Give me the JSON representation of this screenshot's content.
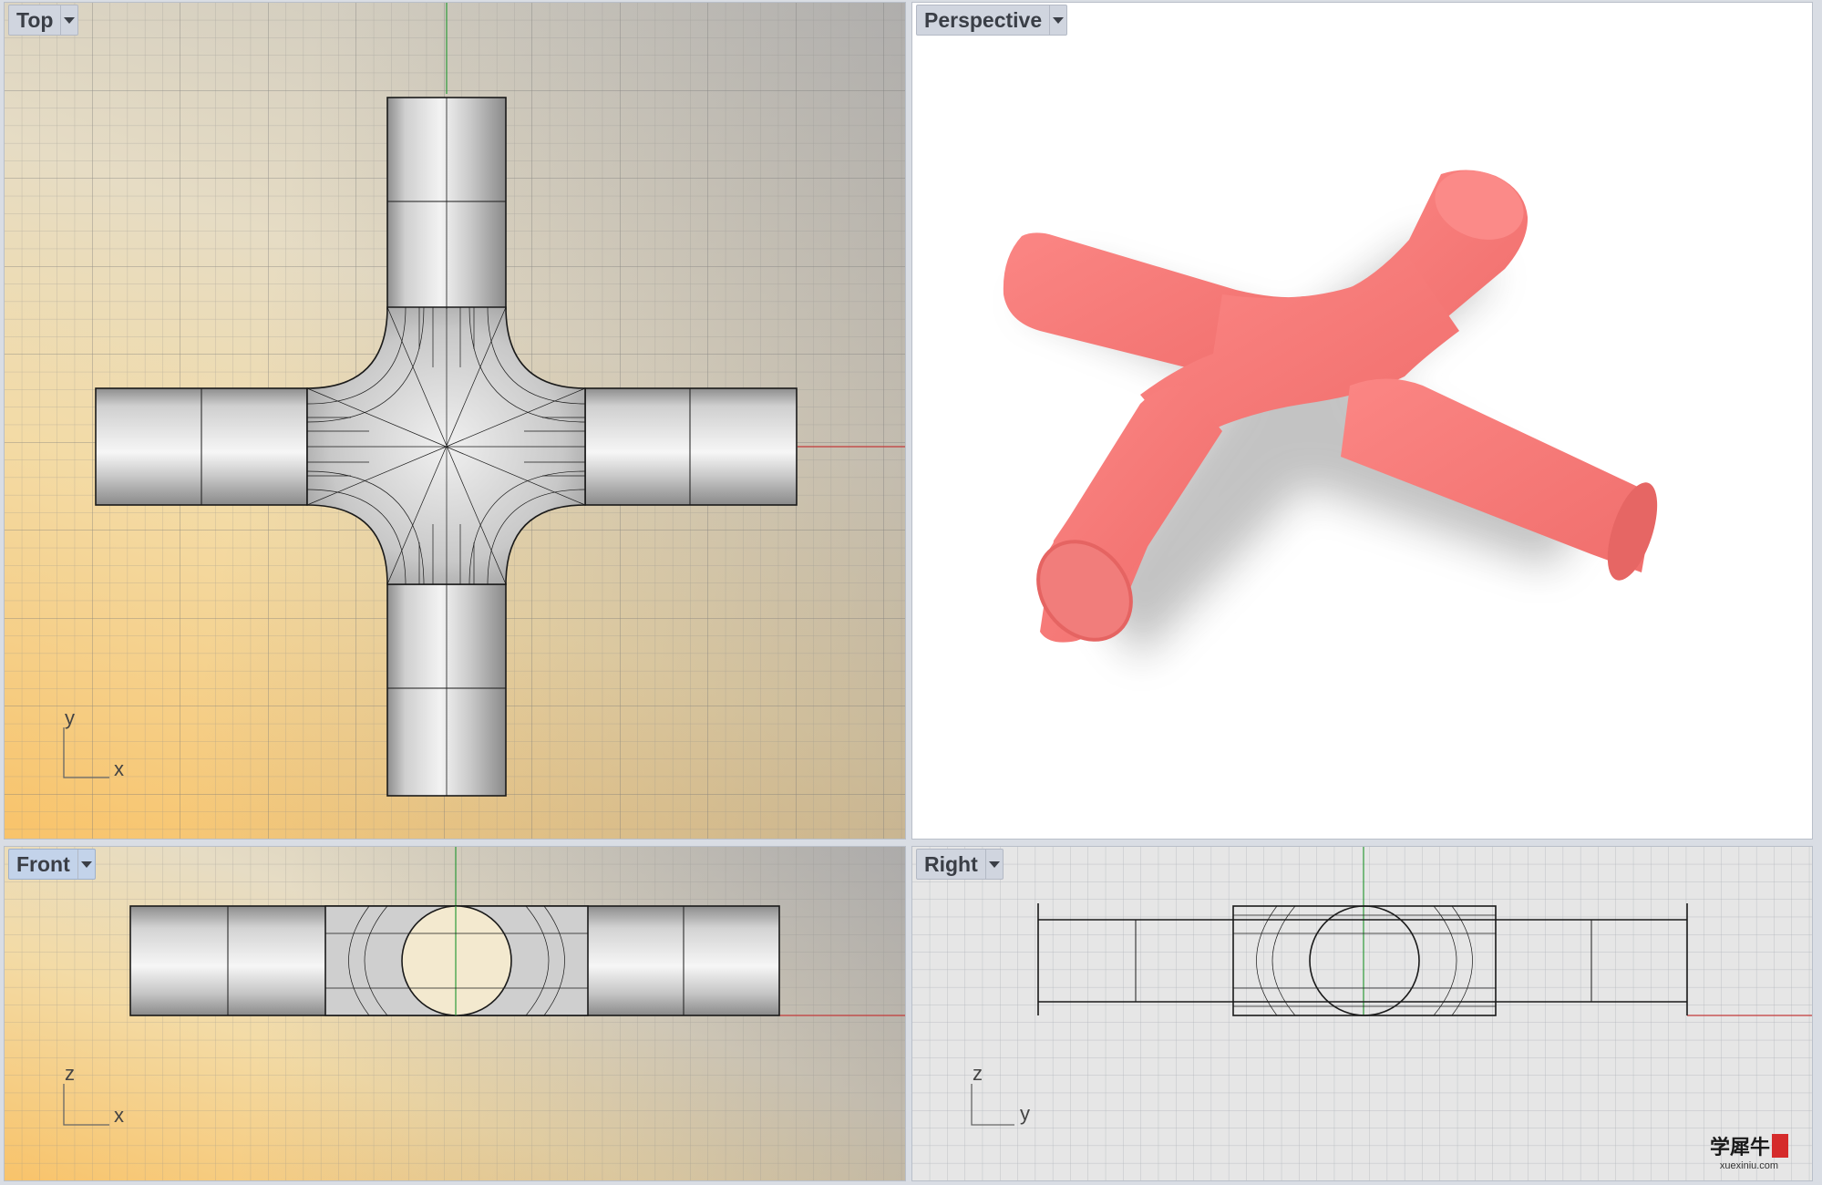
{
  "viewports": {
    "top": {
      "title": "Top",
      "axis_a": "y",
      "axis_b": "x"
    },
    "perspective": {
      "title": "Perspective"
    },
    "front": {
      "title": "Front",
      "axis_a": "z",
      "axis_b": "x"
    },
    "right": {
      "title": "Right",
      "axis_a": "z",
      "axis_b": "y"
    }
  },
  "watermark": {
    "cn": "学犀牛",
    "url": "xuexiniu.com"
  },
  "colors": {
    "model_fill": "#f77a78",
    "x_axis": "#c23a3a",
    "y_axis": "#2e9a3a",
    "grid": "#9aa0a8",
    "active_label": "#c3d3ea"
  },
  "icons": [
    "viewport-menu-dropdown-icon",
    "axis-indicator-icon"
  ]
}
